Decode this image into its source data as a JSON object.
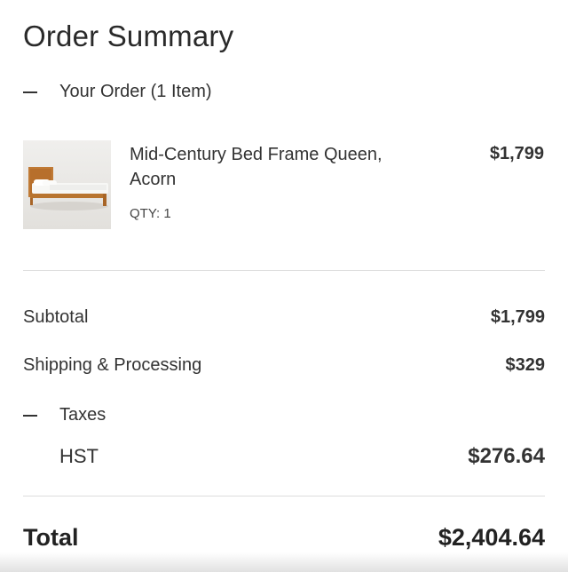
{
  "summary": {
    "title": "Order Summary"
  },
  "order": {
    "toggle_label": "Your Order (1 Item)",
    "items": [
      {
        "name": "Mid-Century Bed Frame Queen, Acorn",
        "qty": "QTY: 1",
        "price": "$1,799",
        "image_icon": "bed-frame-product-image"
      }
    ]
  },
  "totals": {
    "subtotal_label": "Subtotal",
    "subtotal_value": "$1,799",
    "shipping_label": "Shipping & Processing",
    "shipping_value": "$329",
    "taxes_label": "Taxes",
    "hst_label": "HST",
    "hst_value": "$276.64",
    "total_label": "Total",
    "total_value": "$2,404.64"
  },
  "colors": {
    "text": "#333333",
    "divider": "#dddddd",
    "background": "#ffffff",
    "wood": "#b8742f"
  }
}
